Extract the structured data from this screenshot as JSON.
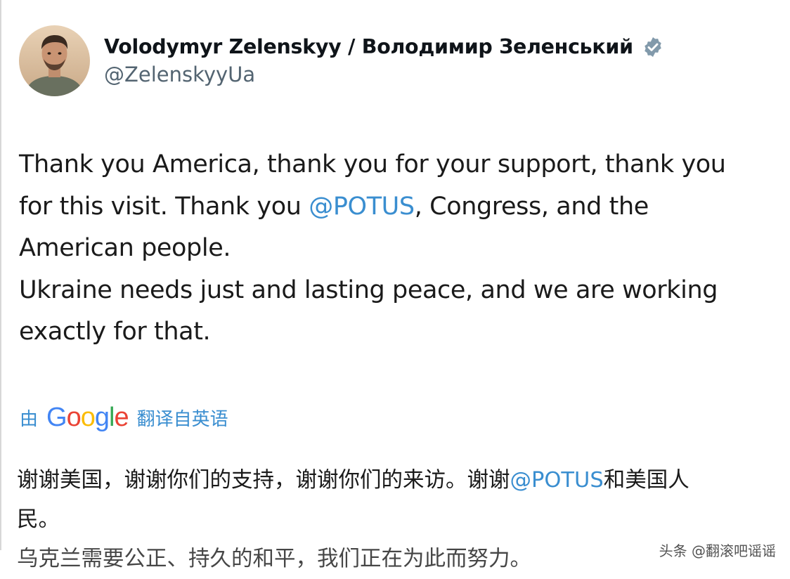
{
  "author": {
    "display_name": "Volodymyr Zelenskyy / Володимир Зеленський",
    "handle": "@ZelenskyyUa",
    "verified_icon": "verified-badge-icon",
    "avatar_icon": "profile-photo"
  },
  "tweet": {
    "line1": "Thank you America, thank you for your support, thank you",
    "line2_before": "for this visit. Thank you ",
    "line2_mention": "@POTUS",
    "line2_after": ", Congress, and the",
    "line3": "American people.",
    "line4": "Ukraine needs just and lasting peace, and we are working",
    "line5": "exactly for that."
  },
  "translation_bar": {
    "prefix": "由",
    "brand": "Google",
    "suffix": "翻译自英语"
  },
  "translated": {
    "line1_before": "谢谢美国，谢谢你们的支持，谢谢你们的来访。谢谢",
    "line1_mention": "@POTUS",
    "line1_after": "和美国人",
    "line2": "民。",
    "line3_partial": "乌克兰需要公正、持久的和平，我们正在为此而努力。"
  },
  "watermark": "头条 @翻滚吧谣谣",
  "colors": {
    "text": "#1a1a1a",
    "handle": "#536471",
    "link": "#3a8ed0",
    "verified": "#829aab"
  }
}
